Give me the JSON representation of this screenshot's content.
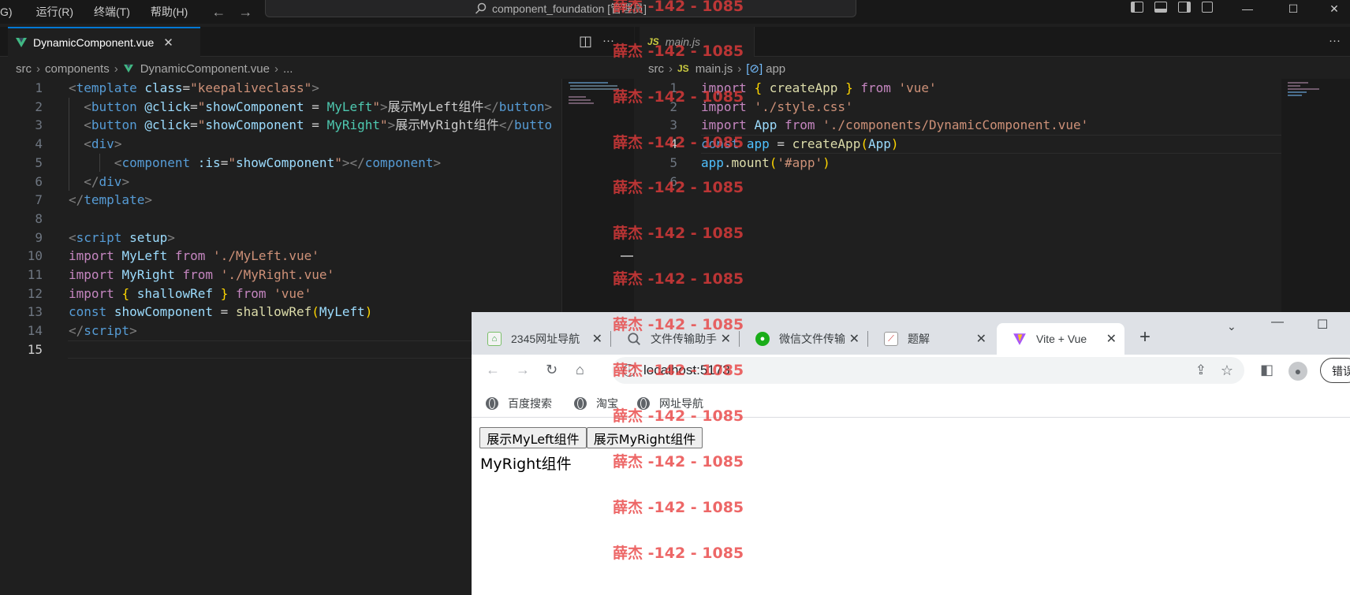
{
  "titlebar": {
    "menu": [
      "G)",
      "运行(R)",
      "终端(T)",
      "帮助(H)"
    ],
    "search_text": "component_foundation [管理员]",
    "nav_back": "←",
    "nav_forward": "→",
    "minimize": "—",
    "maximize": "☐",
    "close": "✕"
  },
  "left_editor": {
    "tab_label": "DynamicComponent.vue",
    "tab_close": "✕",
    "split_icon": "◫",
    "more": "···",
    "breadcrumb": [
      "src",
      "components",
      "DynamicComponent.vue",
      "..."
    ],
    "line_numbers": [
      "1",
      "2",
      "3",
      "4",
      "5",
      "6",
      "7",
      "8",
      "9",
      "10",
      "11",
      "12",
      "13",
      "14",
      "15"
    ],
    "current_line": "15"
  },
  "right_editor": {
    "tab_label": "main.js",
    "more": "···",
    "breadcrumb": [
      "src",
      "main.js",
      "app"
    ],
    "line_numbers": [
      "1",
      "2",
      "3",
      "4",
      "5",
      "6"
    ],
    "current_line": "4"
  },
  "browser": {
    "tabs": [
      {
        "label": "2345网址导航",
        "icon": "2345-favicon"
      },
      {
        "label": "文件传输助手",
        "icon": "search-favicon"
      },
      {
        "label": "微信文件传输",
        "icon": "wechat-favicon"
      },
      {
        "label": "题解",
        "icon": "chart-favicon"
      },
      {
        "label": "Vite + Vue",
        "icon": "vite-favicon",
        "active": true
      }
    ],
    "new_tab": "+",
    "url": "localhost:5173",
    "error_btn": "错误",
    "bookmarks": [
      "百度搜索",
      "淘宝",
      "网址导航"
    ],
    "page": {
      "buttons": [
        "展示MyLeft组件",
        "展示MyRight组件"
      ],
      "text": "MyRight组件"
    }
  },
  "watermark": "薛杰 -142 - 1085"
}
